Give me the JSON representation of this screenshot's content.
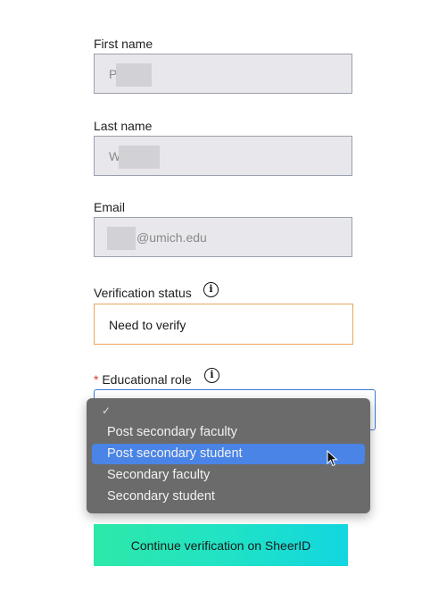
{
  "first_name": {
    "label": "First name",
    "value": "P"
  },
  "last_name": {
    "label": "Last name",
    "value": "W"
  },
  "email": {
    "label": "Email",
    "value": "@umich.edu"
  },
  "verification_status": {
    "label": "Verification status",
    "value": "Need to verify"
  },
  "educational_role": {
    "required_marker": "*",
    "label": "Educational role",
    "options": [
      {
        "label": "",
        "checked": true
      },
      {
        "label": "Post secondary faculty"
      },
      {
        "label": "Post secondary student",
        "highlighted": true
      },
      {
        "label": "Secondary faculty"
      },
      {
        "label": "Secondary student"
      }
    ]
  },
  "checkmark": "✓",
  "info_icon": "i",
  "continue_button": {
    "label": "Continue verification on SheerID"
  },
  "colors": {
    "status_border": "#f0a25c",
    "select_focus": "#3b7bd6",
    "highlight": "#4a84e6",
    "button_gradient_start": "#2ee8a8",
    "button_gradient_end": "#12d6e0"
  }
}
